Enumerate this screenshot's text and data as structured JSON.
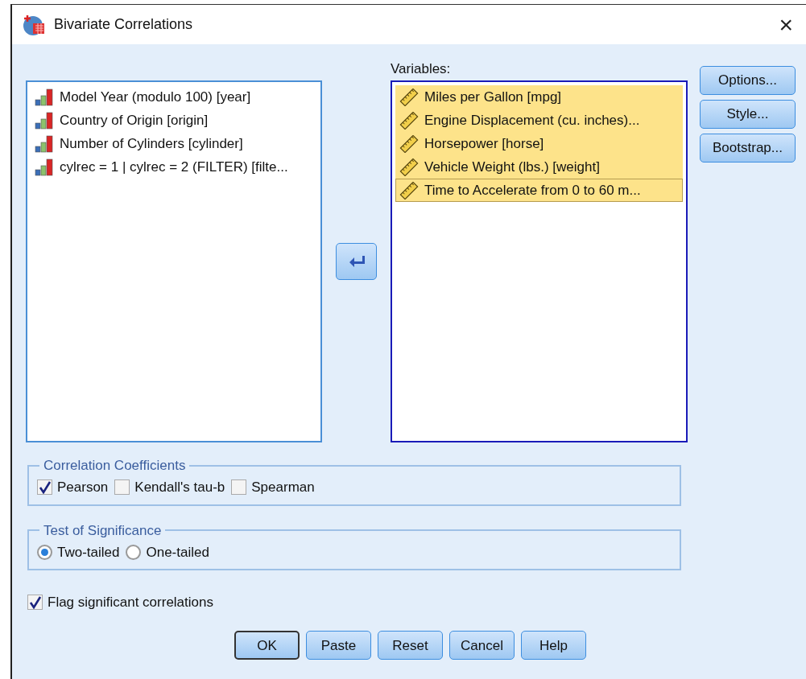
{
  "window": {
    "title": "Bivariate Correlations",
    "close": "×"
  },
  "source_list": {
    "items": [
      {
        "label": "Model Year (modulo 100) [year]",
        "kind": "nominal",
        "selected": false,
        "focused": false
      },
      {
        "label": "Country of Origin [origin]",
        "kind": "nominal",
        "selected": false,
        "focused": false
      },
      {
        "label": "Number of Cylinders [cylinder]",
        "kind": "nominal",
        "selected": false,
        "focused": false
      },
      {
        "label": "cylrec = 1 | cylrec = 2 (FILTER) [filte...",
        "kind": "nominal",
        "selected": false,
        "focused": false
      }
    ]
  },
  "variables": {
    "label": "Variables:",
    "items": [
      {
        "label": "Miles per Gallon [mpg]",
        "kind": "scale",
        "selected": true,
        "focused": false
      },
      {
        "label": "Engine Displacement (cu. inches)...",
        "kind": "scale",
        "selected": true,
        "focused": false
      },
      {
        "label": "Horsepower [horse]",
        "kind": "scale",
        "selected": true,
        "focused": false
      },
      {
        "label": "Vehicle Weight (lbs.) [weight]",
        "kind": "scale",
        "selected": true,
        "focused": false
      },
      {
        "label": "Time to Accelerate from 0 to 60 m...",
        "kind": "scale",
        "selected": true,
        "focused": true
      }
    ]
  },
  "side_buttons": [
    {
      "label": "Options..."
    },
    {
      "label": "Style..."
    },
    {
      "label": "Bootstrap..."
    }
  ],
  "correlation_coefficients": {
    "title": "Correlation Coefficients",
    "options": [
      {
        "label": "Pearson",
        "checked": true
      },
      {
        "label": "Kendall's tau-b",
        "checked": false
      },
      {
        "label": "Spearman",
        "checked": false
      }
    ]
  },
  "test_of_significance": {
    "title": "Test of Significance",
    "options": [
      {
        "label": "Two-tailed",
        "selected": true
      },
      {
        "label": "One-tailed",
        "selected": false
      }
    ]
  },
  "flag_significant": {
    "label": "Flag significant correlations",
    "checked": true
  },
  "buttons": [
    {
      "label": "OK",
      "default": true
    },
    {
      "label": "Paste",
      "default": false
    },
    {
      "label": "Reset",
      "default": false
    },
    {
      "label": "Cancel",
      "default": false
    },
    {
      "label": "Help",
      "default": false
    }
  ]
}
